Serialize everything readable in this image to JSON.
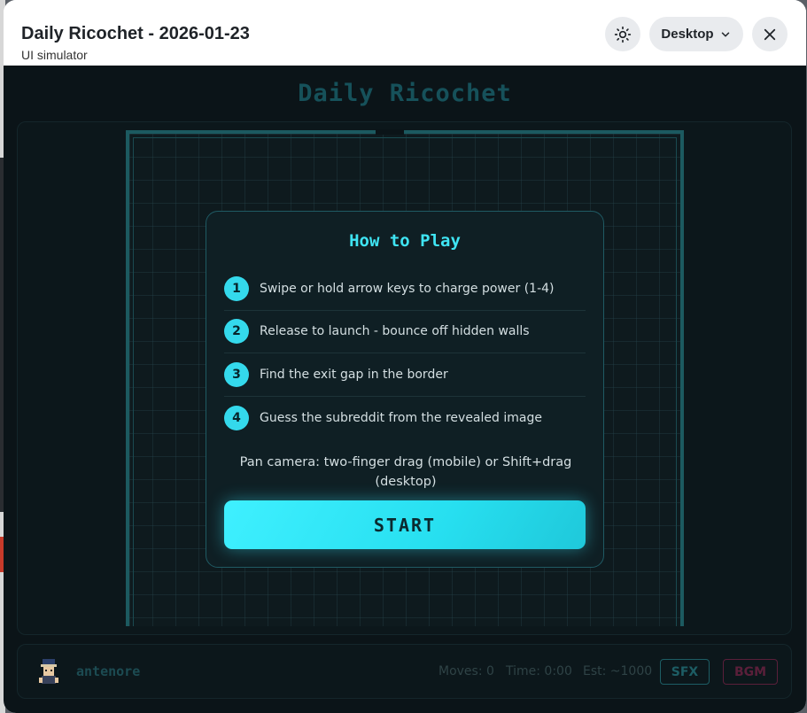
{
  "header": {
    "title": "Daily Ricochet - 2026-01-23",
    "subtitle": "UI simulator",
    "device_label": "Desktop"
  },
  "game": {
    "title": "Daily Ricochet"
  },
  "how_to_play": {
    "title": "How to Play",
    "steps": [
      {
        "num": "1",
        "text": "Swipe or hold arrow keys to charge power (1-4)"
      },
      {
        "num": "2",
        "text": "Release to launch - bounce off hidden walls"
      },
      {
        "num": "3",
        "text": "Find the exit gap in the border"
      },
      {
        "num": "4",
        "text": "Guess the subreddit from the revealed image"
      }
    ],
    "pan_note": "Pan camera: two-finger drag (mobile) or Shift+drag (desktop)",
    "start_label": "START"
  },
  "footer": {
    "username": "antenore",
    "moves": "Moves: 0",
    "time": "Time: 0:00",
    "est": "Est: ~1000",
    "sfx_label": "SFX",
    "bgm_label": "BGM"
  },
  "colors": {
    "accent": "#34d9ec",
    "board_border": "#1c5a60",
    "sfx": "#1d5d64",
    "bgm": "#5a1f3a"
  },
  "icons": {
    "theme": "sun-icon",
    "device": "chevron-down-icon",
    "close": "close-icon"
  }
}
